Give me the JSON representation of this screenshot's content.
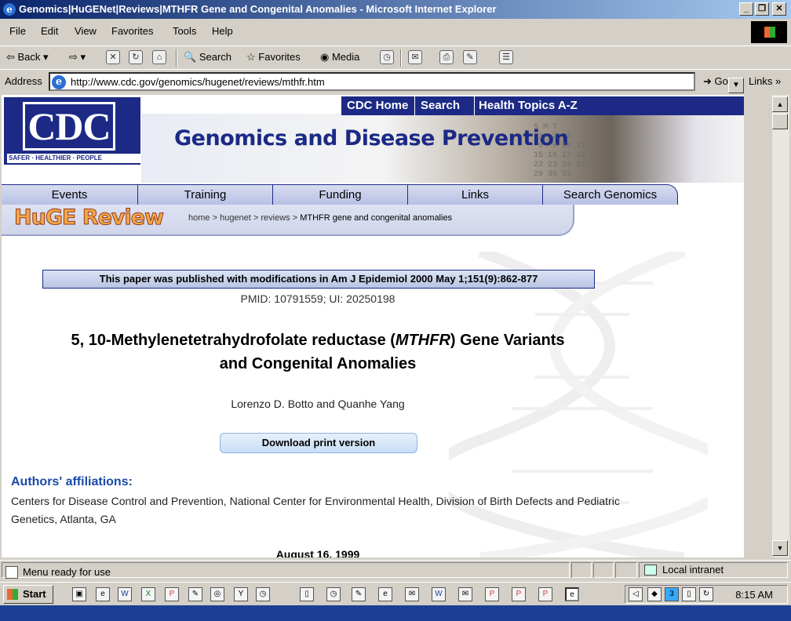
{
  "window": {
    "title": "Genomics|HuGENet|Reviews|MTHFR Gene and Congenital Anomalies - Microsoft Internet Explorer"
  },
  "menu": [
    "File",
    "Edit",
    "View",
    "Favorites",
    "Tools",
    "Help"
  ],
  "toolbar": {
    "back": "Back",
    "search": "Search",
    "favorites": "Favorites",
    "media": "Media"
  },
  "address": {
    "label": "Address",
    "url": "http://www.cdc.gov/genomics/hugenet/reviews/mthfr.htm",
    "go": "Go",
    "links": "Links"
  },
  "site": {
    "logo_text": "CDC",
    "logo_tagline": "SAFER · HEALTHIER · PEOPLE",
    "banner_title": "Genomics and Disease Prevention",
    "calendar": "S M T\n 1  2  3\n 8  9 10 11\n15 16 17 18\n22 23 24 25\n29 30 31",
    "top_nav": [
      "CDC Home",
      "Search",
      "Health Topics A-Z"
    ],
    "main_nav": [
      "Events",
      "Training",
      "Funding",
      "Links",
      "Search Genomics"
    ],
    "section_logo": "HuGE Review",
    "breadcrumb": [
      "home",
      "hugenet",
      "reviews",
      "MTHFR gene and congenital anomalies"
    ]
  },
  "article": {
    "pub_note": "This paper was published with modifications in Am J Epidemiol 2000 May 1;151(9):862-877",
    "pmid": "PMID: 10791559; UI: 20250198",
    "title_line1_before": "5, 10-Methylenetetrahydrofolate reductase (",
    "title_line1_italic": "MTHFR",
    "title_line1_after": ") Gene Variants",
    "title_line2": "and Congenital Anomalies",
    "authors": "Lorenzo D. Botto and Quanhe Yang",
    "download": "Download print version",
    "affiliations_heading": "Authors' affiliations:",
    "affiliations_text": "Centers for Disease Control and Prevention, National Center for Environmental Health, Division of Birth Defects and Pediatric Genetics, Atlanta, GA",
    "date": "August 16, 1999"
  },
  "status": {
    "text": "Menu ready for use",
    "zone": "Local intranet"
  },
  "taskbar": {
    "start": "Start",
    "clock": "8:15 AM"
  },
  "colors": {
    "cdc_blue": "#1c2a86",
    "link_blue": "#1a4aa8",
    "titlebar_start": "#0a246a",
    "huge_orange": "#f0a848"
  }
}
